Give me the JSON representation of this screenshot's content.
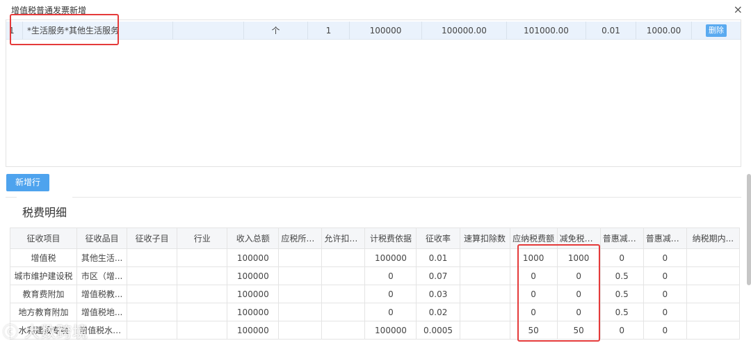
{
  "dialog": {
    "title": "增值税普通发票新增",
    "close_icon": "×"
  },
  "item_row": {
    "index": "1",
    "name": "*生活服务*其他生活服务",
    "spec": "",
    "model": "",
    "unit": "个",
    "quantity": "1",
    "price": "100000",
    "amount": "100000.00",
    "amount_with_tax": "101000.00",
    "tax_rate": "0.01",
    "tax": "1000.00",
    "delete_label": "删除"
  },
  "add_row_label": "新增行",
  "section_title": "税费明细",
  "tax_table": {
    "headers": [
      "征收项目",
      "征收品目",
      "征收子目",
      "行业",
      "收入总额",
      "应税所得...",
      "允许扣除...",
      "计税费依据",
      "征收率",
      "速算扣除数",
      "应纳税费额",
      "减免税费...",
      "普惠减征...",
      "普惠减免...",
      "纳税期内..."
    ],
    "rows": [
      [
        "增值税",
        "其他生活...",
        "",
        "",
        "100000",
        "",
        "",
        "100000",
        "0.01",
        "",
        "1000",
        "1000",
        "0",
        "0",
        ""
      ],
      [
        "城市维护建设税",
        "市区（增...",
        "",
        "",
        "100000",
        "",
        "",
        "0",
        "0.07",
        "",
        "0",
        "0",
        "0.5",
        "0",
        ""
      ],
      [
        "教育费附加",
        "增值税教...",
        "",
        "",
        "100000",
        "",
        "",
        "0",
        "0.03",
        "",
        "0",
        "0",
        "0.5",
        "0",
        ""
      ],
      [
        "地方教育附加",
        "增值税地...",
        "",
        "",
        "100000",
        "",
        "",
        "0",
        "0.02",
        "",
        "0",
        "0",
        "0.5",
        "0",
        ""
      ],
      [
        "水利建设专项",
        "增值税水利...",
        "",
        "",
        "100000",
        "",
        "",
        "100000",
        "0.0005",
        "",
        "50",
        "50",
        "0",
        "0",
        ""
      ]
    ]
  },
  "watermark": "大数跨境",
  "colors": {
    "highlight_red": "#e53a3a",
    "row_selected": "#eaf2fc",
    "button_blue": "#4ea3ee"
  }
}
